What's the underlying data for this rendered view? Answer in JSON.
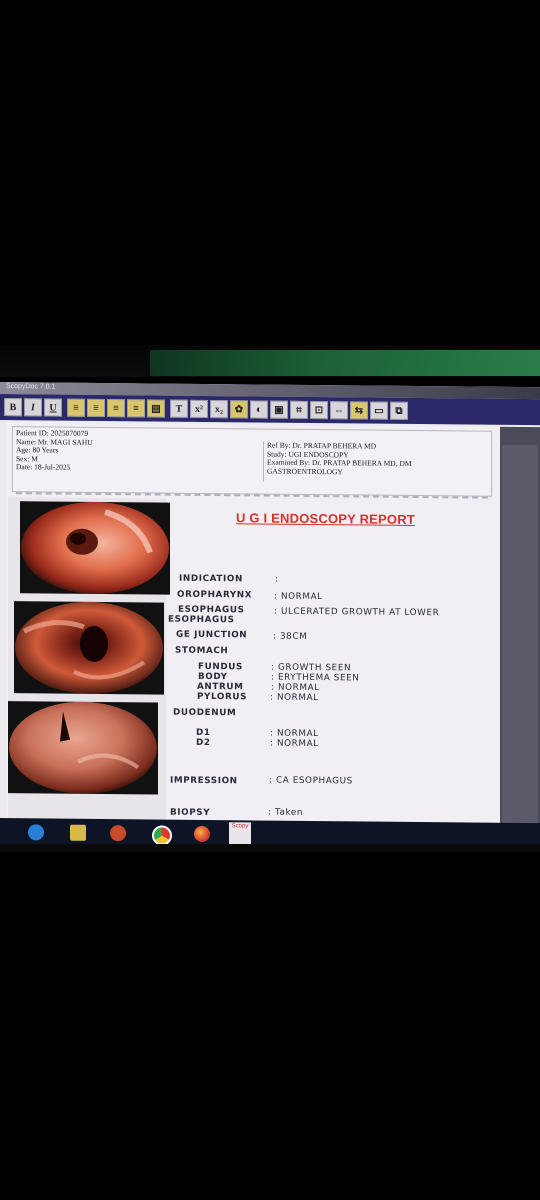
{
  "app": {
    "title": "ScopyDoc 7.0.1"
  },
  "toolbar": {
    "buttons": [
      "B",
      "I",
      "U",
      "T"
    ]
  },
  "patient": {
    "id": "Patient ID: 2025070079",
    "name": "Name: Mr. MAGI SAHU",
    "age": "Age: 80 Years",
    "sex": "Sex: M",
    "date": "Date: 18-Jul-2025"
  },
  "doctor": {
    "ref": "Ref By: Dr. PRATAP BEHERA MD",
    "study": "Study: UGI ENDOSCOPY",
    "examined": "Examined By: Dr. PRATAP BEHERA MD, DM",
    "dept": "GASTROENTROLOGY"
  },
  "report": {
    "title": "U G I ENDOSCOPY REPORT",
    "rows": [
      {
        "label": "INDICATION",
        "value": ":"
      },
      {
        "label": "OROPHARYNX",
        "value": ": NORMAL"
      },
      {
        "label": "ESOPHAGUS",
        "value": ": ULCERATED GROWTH AT LOWER"
      },
      {
        "label": "ESOPHAGUS",
        "value": ""
      },
      {
        "label": "GE JUNCTION",
        "value": ": 38CM"
      },
      {
        "label": "STOMACH",
        "value": ""
      },
      {
        "label": "FUNDUS",
        "value": ": GROWTH SEEN"
      },
      {
        "label": "BODY",
        "value": ": ERYTHEMA SEEN"
      },
      {
        "label": "ANTRUM",
        "value": ": NORMAL"
      },
      {
        "label": "PYLORUS",
        "value": ": NORMAL"
      },
      {
        "label": "DUODENUM",
        "value": ""
      },
      {
        "label": "D1",
        "value": ": NORMAL"
      },
      {
        "label": "D2",
        "value": ": NORMAL"
      },
      {
        "label": "IMPRESSION",
        "value": ": CA ESOPHAGUS"
      },
      {
        "label": "BIOPSY",
        "value": ": Taken"
      }
    ]
  },
  "taskbar": {
    "app_label": "Scopy"
  }
}
